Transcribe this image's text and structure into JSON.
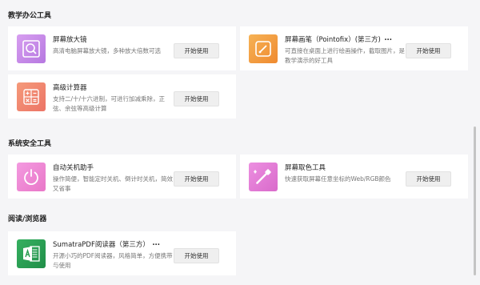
{
  "sections": {
    "teaching": "教学办公工具",
    "security": "系统安全工具",
    "reading": "阅读/浏览器"
  },
  "button_label": "开始使用",
  "tools": {
    "magnifier": {
      "name": "屏幕放大镜",
      "desc": "高清电脑屏幕放大镜，多种放大倍数可选",
      "icon": "magnifier-icon",
      "color": "#c88ee8"
    },
    "pen": {
      "name": "屏幕画笔（Pointofix）(第三方)",
      "more": "...",
      "desc": "可直接在桌面上进行绘画操作，截取图片，是教学演示的好工具",
      "icon": "pen-icon",
      "color": "#f2a040"
    },
    "calculator": {
      "name": "高级计算器",
      "desc": "支持二/十/十六进制，可进行加减乘除，正弦、余弦等高级计算",
      "icon": "calculator-icon",
      "color": "#f08870"
    },
    "shutdown": {
      "name": "自动关机助手",
      "desc": "操作简便，智能定时关机、倒计时关机，简效又省事",
      "icon": "power-icon",
      "color": "#ee88d2"
    },
    "colorpicker": {
      "name": "屏幕取色工具",
      "desc": "快速获取屏幕任意坐标的Web/RGB颜色",
      "icon": "eyedropper-icon",
      "color": "#e57ad2"
    },
    "sumatra": {
      "name": "SumatraPDF阅读器（第三方）",
      "more": "...",
      "desc": "开源小巧的PDF阅读器，风格简单，方便携带与使用",
      "icon": "pdf-icon",
      "color": "#2aa455"
    }
  }
}
